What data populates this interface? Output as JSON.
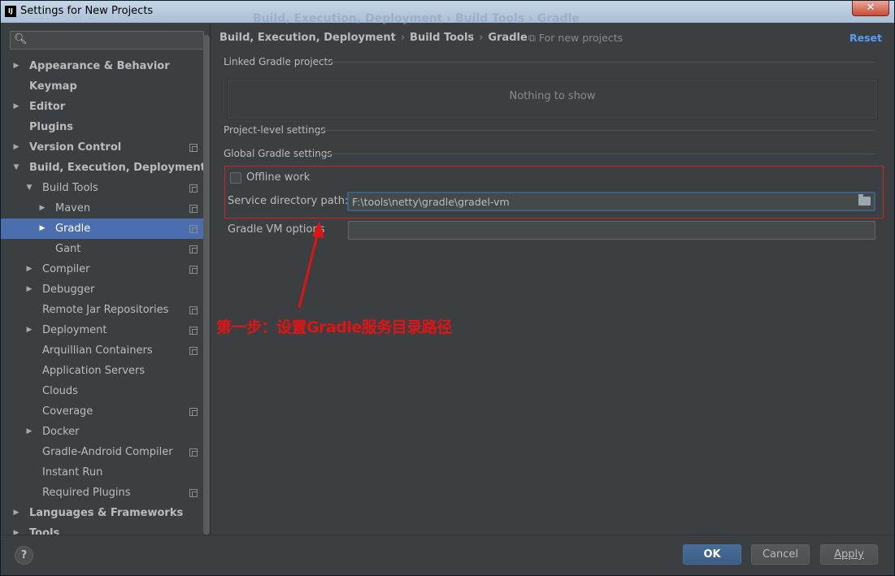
{
  "window": {
    "title": "Settings for New Projects",
    "logo": "IJ",
    "background_title": "Build, Execution, Deployment  ›  Build Tools  ›  Gradle",
    "close_glyph": "✕"
  },
  "search": {
    "placeholder": "",
    "icon": "search-icon"
  },
  "sidebar": {
    "items": [
      {
        "label": "Appearance & Behavior",
        "bold": true,
        "level": 0,
        "arrow": "▶",
        "proj": false
      },
      {
        "label": "Keymap",
        "bold": true,
        "level": 0,
        "arrow": "",
        "proj": false
      },
      {
        "label": "Editor",
        "bold": true,
        "level": 0,
        "arrow": "▶",
        "proj": false
      },
      {
        "label": "Plugins",
        "bold": true,
        "level": 0,
        "arrow": "",
        "proj": false
      },
      {
        "label": "Version Control",
        "bold": true,
        "level": 0,
        "arrow": "▶",
        "proj": true
      },
      {
        "label": "Build, Execution, Deployment",
        "bold": true,
        "level": 0,
        "arrow": "▼",
        "proj": false
      },
      {
        "label": "Build Tools",
        "bold": false,
        "level": 1,
        "arrow": "▼",
        "proj": true
      },
      {
        "label": "Maven",
        "bold": false,
        "level": 2,
        "arrow": "▶",
        "proj": true
      },
      {
        "label": "Gradle",
        "bold": false,
        "level": 2,
        "arrow": "▶",
        "proj": true,
        "selected": true
      },
      {
        "label": "Gant",
        "bold": false,
        "level": 2,
        "arrow": "",
        "proj": true
      },
      {
        "label": "Compiler",
        "bold": false,
        "level": 1,
        "arrow": "▶",
        "proj": true
      },
      {
        "label": "Debugger",
        "bold": false,
        "level": 1,
        "arrow": "▶",
        "proj": false
      },
      {
        "label": "Remote Jar Repositories",
        "bold": false,
        "level": 1,
        "arrow": "",
        "proj": true
      },
      {
        "label": "Deployment",
        "bold": false,
        "level": 1,
        "arrow": "▶",
        "proj": true
      },
      {
        "label": "Arquillian Containers",
        "bold": false,
        "level": 1,
        "arrow": "",
        "proj": true
      },
      {
        "label": "Application Servers",
        "bold": false,
        "level": 1,
        "arrow": "",
        "proj": false
      },
      {
        "label": "Clouds",
        "bold": false,
        "level": 1,
        "arrow": "",
        "proj": false
      },
      {
        "label": "Coverage",
        "bold": false,
        "level": 1,
        "arrow": "",
        "proj": true
      },
      {
        "label": "Docker",
        "bold": false,
        "level": 1,
        "arrow": "▶",
        "proj": false
      },
      {
        "label": "Gradle-Android Compiler",
        "bold": false,
        "level": 1,
        "arrow": "",
        "proj": true
      },
      {
        "label": "Instant Run",
        "bold": false,
        "level": 1,
        "arrow": "",
        "proj": false
      },
      {
        "label": "Required Plugins",
        "bold": false,
        "level": 1,
        "arrow": "",
        "proj": true
      },
      {
        "label": "Languages & Frameworks",
        "bold": true,
        "level": 0,
        "arrow": "▶",
        "proj": false
      },
      {
        "label": "Tools",
        "bold": true,
        "level": 0,
        "arrow": "▶",
        "proj": false
      }
    ]
  },
  "main": {
    "breadcrumb": [
      "Build, Execution, Deployment",
      "Build Tools",
      "Gradle"
    ],
    "breadcrumb_sep": "›",
    "for_new_projects": "⧉ For new projects",
    "reset": "Reset",
    "linked_projects_label": "Linked Gradle projects",
    "nothing_to_show": "Nothing to show",
    "project_level_label": "Project-level settings",
    "global_label": "Global Gradle settings",
    "offline_work": "Offline work",
    "offline_checked": false,
    "service_dir_label": "Service directory path:",
    "service_dir_value": "F:\\tools\\netty\\gradle\\gradel-vm",
    "vm_options_label": "Gradle VM options",
    "vm_options_value": "",
    "annotation": "第一步：设置Gradle服务目录路径",
    "annotation_color": "#e01414"
  },
  "buttons": {
    "help": "?",
    "ok": "OK",
    "cancel": "Cancel",
    "apply": "Apply"
  }
}
